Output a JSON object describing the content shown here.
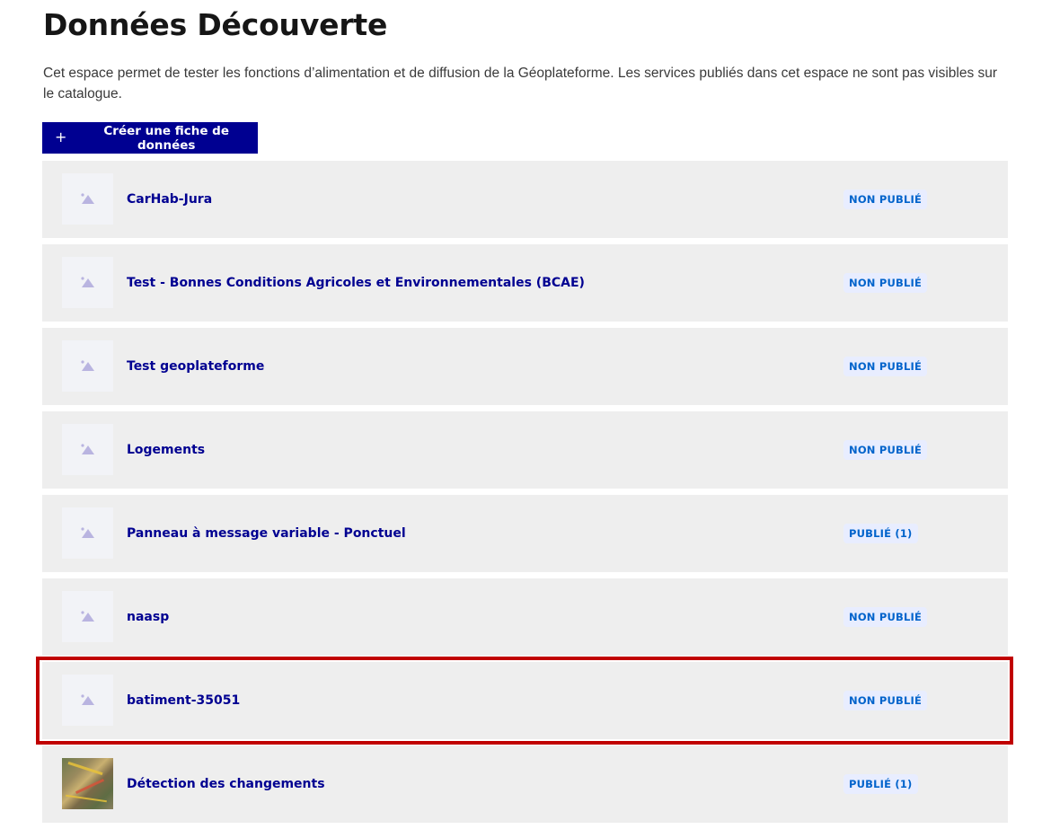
{
  "page": {
    "title": "Données Découverte",
    "description": "Cet espace permet de tester les fonctions d’alimentation et de diffusion de la Géoplateforme. Les services publiés dans cet espace ne sont pas visibles sur le catalogue."
  },
  "actions": {
    "create_label": "Créer une fiche de données",
    "create_icon": "plus-icon"
  },
  "colors": {
    "primary": "#000091",
    "badge_text": "#0063cb",
    "badge_bg": "#e8edff",
    "item_bg": "#eeeeee",
    "highlight": "#c00000"
  },
  "datasets": [
    {
      "title": "CarHab-Jura",
      "status": "NON PUBLIÉ",
      "thumbnail": "image-placeholder-icon"
    },
    {
      "title": "Test - Bonnes Conditions Agricoles et Environnementales (BCAE)",
      "status": "NON PUBLIÉ",
      "thumbnail": "image-placeholder-icon"
    },
    {
      "title": "Test geoplateforme",
      "status": "NON PUBLIÉ",
      "thumbnail": "image-placeholder-icon"
    },
    {
      "title": "Logements",
      "status": "NON PUBLIÉ",
      "thumbnail": "image-placeholder-icon"
    },
    {
      "title": "Panneau à message variable - Ponctuel",
      "status": "PUBLIÉ (1)",
      "thumbnail": "image-placeholder-icon"
    },
    {
      "title": "naasp",
      "status": "NON PUBLIÉ",
      "thumbnail": "image-placeholder-icon"
    },
    {
      "title": "batiment-35051",
      "status": "NON PUBLIÉ",
      "thumbnail": "image-placeholder-icon"
    },
    {
      "title": "Détection des changements",
      "status": "PUBLIÉ (1)",
      "thumbnail": "aerial-photo-thumbnail"
    }
  ]
}
